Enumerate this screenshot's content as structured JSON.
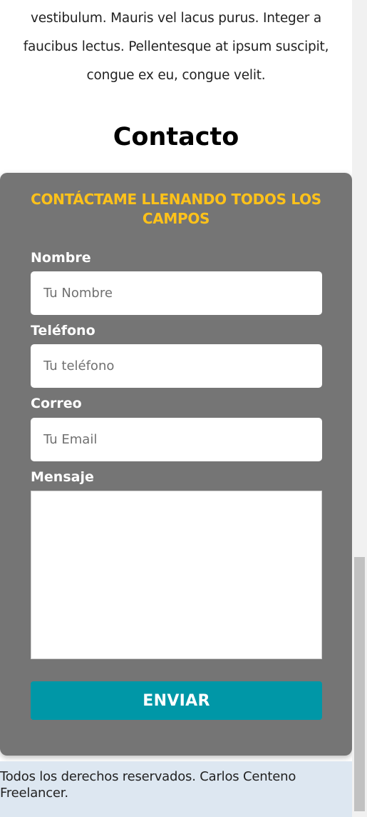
{
  "about": {
    "text_lines": [
      "vestibulum. Mauris vel lacus purus. Integer a",
      "faucibus lectus. Pellentesque at ipsum suscipit,",
      "congue ex eu, congue velit."
    ]
  },
  "contact": {
    "title": "Contacto",
    "form": {
      "legend": "CONTÁCTAME LLENANDO TODOS LOS CAMPOS",
      "fields": [
        {
          "label": "Nombre",
          "placeholder": "Tu Nombre",
          "value": ""
        },
        {
          "label": "Teléfono",
          "placeholder": "Tu teléfono",
          "value": ""
        },
        {
          "label": "Correo",
          "placeholder": "Tu Email",
          "value": ""
        }
      ],
      "message": {
        "label": "Mensaje",
        "value": ""
      },
      "submit_label": "ENVIAR"
    }
  },
  "footer": {
    "text": "Todos los derechos reservados. Carlos Centeno Freelancer."
  },
  "colors": {
    "form_background": "#757575",
    "legend_accent": "#ffc21a",
    "button_background": "#0097a7",
    "footer_background": "#dde7f1"
  }
}
